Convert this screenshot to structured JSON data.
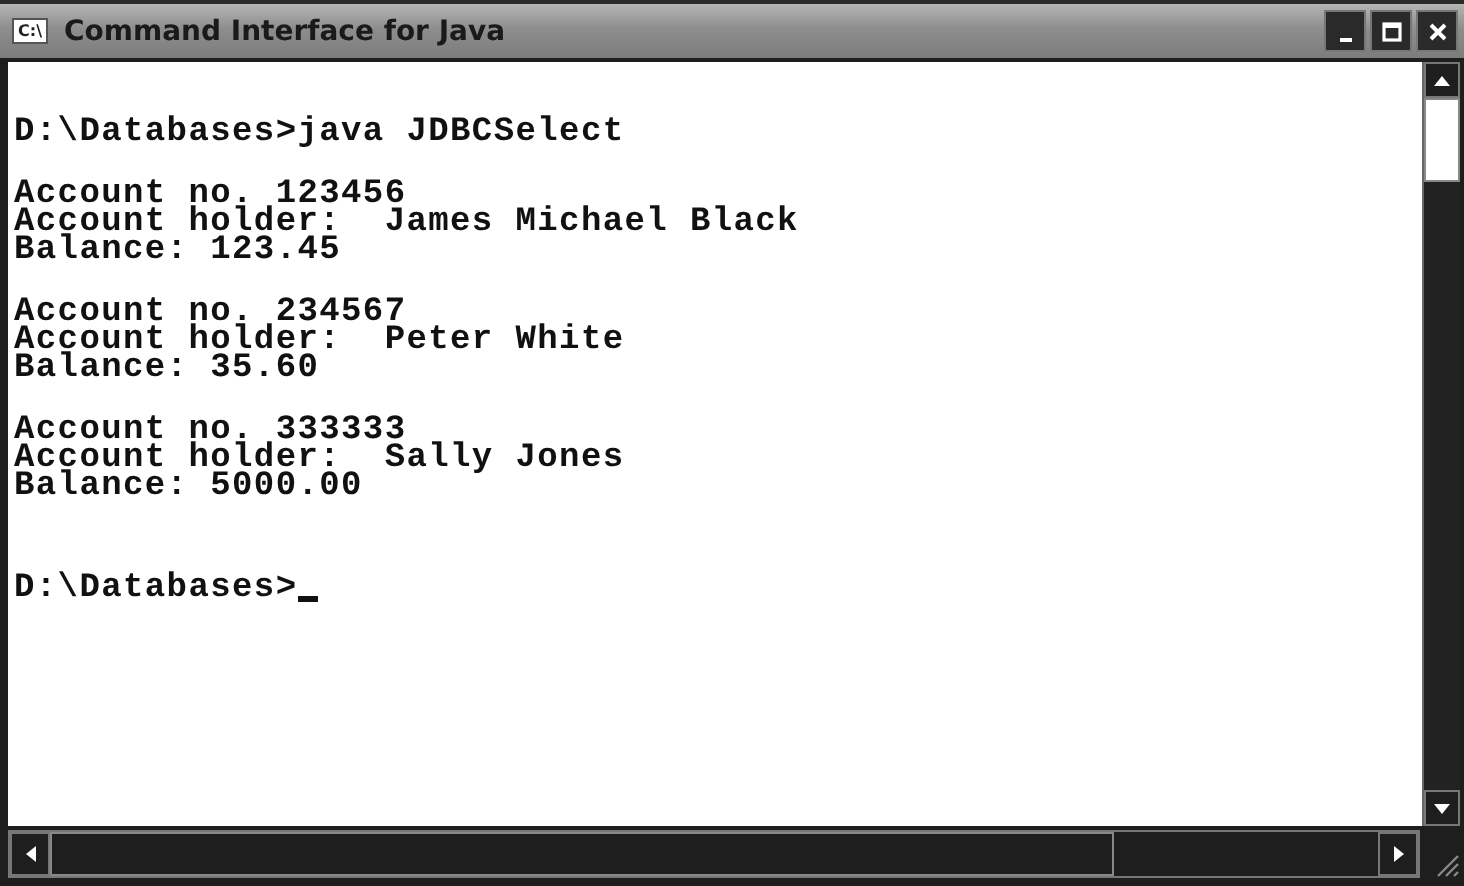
{
  "window": {
    "title": "Command Interface for Java",
    "icon_text": "C:\\"
  },
  "console": {
    "command_line": "D:\\Databases>java JDBCSelect",
    "records": [
      [
        "Account no. 123456",
        "Account holder:  James Michael Black",
        "Balance: 123.45"
      ],
      [
        "Account no. 234567",
        "Account holder:  Peter White",
        "Balance: 35.60"
      ],
      [
        "Account no. 333333",
        "Account holder:  Sally Jones",
        "Balance: 5000.00"
      ]
    ],
    "prompt": "D:\\Databases>"
  }
}
